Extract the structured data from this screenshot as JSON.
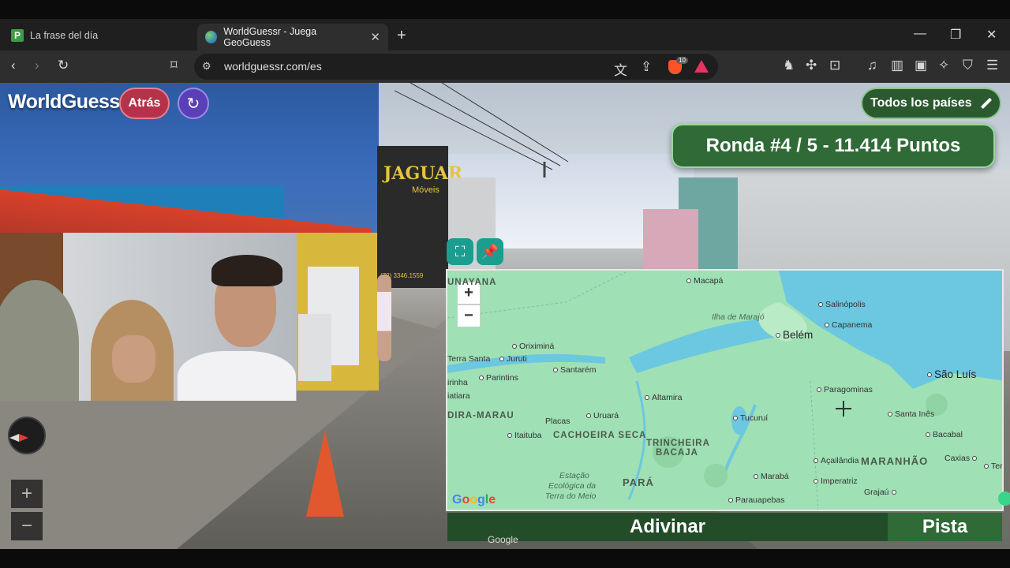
{
  "browser": {
    "tabs": [
      {
        "title": "La frase del día",
        "favicon": "p-icon"
      },
      {
        "title": "WorldGuessr - Juega GeoGuess",
        "favicon": "globe-icon"
      }
    ],
    "url": "worldguessr.com/es",
    "shields_count": "10"
  },
  "game": {
    "logo": "WorldGuessr",
    "back_label": "Atrás",
    "countries_label": "Todos los países",
    "round_text": "Ronda #4 / 5 - 11.414 Puntos",
    "guess_label": "Adivinar",
    "hint_label": "Pista"
  },
  "streetview": {
    "shop_name": "JAGUAR",
    "shop_sub": "Móveis",
    "shop_phone": "(79) 3346.1559",
    "watermark": "Google"
  },
  "map": {
    "attribution": "Google",
    "labels": {
      "macapa": "Macapá",
      "salinopolis": "Salinópolis",
      "ilha_marajo": "Ilha de Marajó",
      "belem": "Belém",
      "capanema": "Capanema",
      "oriximina": "Oriximiná",
      "terra_santa": "Terra Santa",
      "juruti": "Juruti",
      "santarem": "Santarém",
      "parintins": "Parintins",
      "sao_luis": "São Luís",
      "paragominas": "Paragominas",
      "altamira": "Altamira",
      "santa_ines": "Santa Inês",
      "placas": "Placas",
      "uruara": "Uruará",
      "tucurui": "Tucuruí",
      "itaituba": "Itaituba",
      "bacabal": "Bacabal",
      "acailandia": "Açailândia",
      "caxias": "Caxias",
      "maraba": "Marabá",
      "imperatriz": "Imperatriz",
      "grajau": "Grajaú",
      "parauapebas": "Parauapebas",
      "unayana": "UNAYANA",
      "dira_marau": "DIRA-MARAU",
      "cachoeira_seca": "CACHOEIRA SECA",
      "trincheira1": "TRINCHEIRA",
      "trincheira2": "BACAJA",
      "para": "PARÁ",
      "maranhao": "MARANHÃO",
      "estacao1": "Estação",
      "estacao2": "Ecológica da",
      "estacao3": "Terra do Meio",
      "irinha": "irinha",
      "iatiara": "iatiara",
      "tere": "Tere"
    }
  },
  "colors": {
    "map_land": "#9fe0b5",
    "map_water": "#6cc7e0",
    "round_bg": "#2f6a37",
    "back_bg": "#b5334a",
    "reload_bg": "#5a3fb8"
  }
}
